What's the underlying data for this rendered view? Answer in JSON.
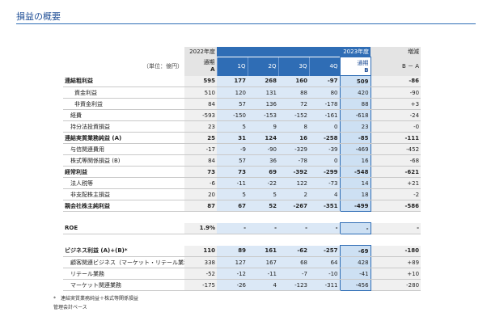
{
  "page": {
    "title": "損益の概要"
  },
  "table": {
    "unit": "（単位：億円）",
    "fy2022": "2022年度",
    "fy2023": "2023年度",
    "full_year": "通期",
    "col_a": "A",
    "col_b": "B",
    "q1": "1Q",
    "q2": "2Q",
    "q3": "3Q",
    "q4": "4Q",
    "diff_label": "増減",
    "diff_formula": "B － A",
    "rows": [
      {
        "label": "連結粗利益",
        "a": "595",
        "q1": "177",
        "q2": "268",
        "q3": "160",
        "q4": "-97",
        "b": "509",
        "d": "-86"
      },
      {
        "label": "資金利益",
        "a": "510",
        "q1": "120",
        "q2": "131",
        "q3": "88",
        "q4": "80",
        "b": "420",
        "d": "-90"
      },
      {
        "label": "非資金利益",
        "a": "84",
        "q1": "57",
        "q2": "136",
        "q3": "72",
        "q4": "-178",
        "b": "88",
        "d": "+3"
      },
      {
        "label": "経費",
        "a": "-593",
        "q1": "-150",
        "q2": "-153",
        "q3": "-152",
        "q4": "-161",
        "b": "-618",
        "d": "-24"
      },
      {
        "label": "持分法投資損益",
        "a": "23",
        "q1": "5",
        "q2": "9",
        "q3": "8",
        "q4": "0",
        "b": "23",
        "d": "-0"
      },
      {
        "label": "連結実質業務純益 (A)",
        "a": "25",
        "q1": "31",
        "q2": "124",
        "q3": "16",
        "q4": "-258",
        "b": "-85",
        "d": "-111"
      },
      {
        "label": "与信関連費用",
        "a": "-17",
        "q1": "-9",
        "q2": "-90",
        "q3": "-329",
        "q4": "-39",
        "b": "-469",
        "d": "-452"
      },
      {
        "label": "株式等関係損益 (B)",
        "a": "84",
        "q1": "57",
        "q2": "36",
        "q3": "-78",
        "q4": "0",
        "b": "16",
        "d": "-68"
      },
      {
        "label": "経常利益",
        "a": "73",
        "q1": "73",
        "q2": "69",
        "q3": "-392",
        "q4": "-299",
        "b": "-548",
        "d": "-621"
      },
      {
        "label": "法人税等",
        "a": "-6",
        "q1": "-11",
        "q2": "-22",
        "q3": "122",
        "q4": "-73",
        "b": "14",
        "d": "+21"
      },
      {
        "label": "非支配株主損益",
        "a": "20",
        "q1": "5",
        "q2": "5",
        "q3": "2",
        "q4": "4",
        "b": "18",
        "d": "-2"
      },
      {
        "label": "親会社株主純利益",
        "a": "87",
        "q1": "67",
        "q2": "52",
        "q3": "-267",
        "q4": "-351",
        "b": "-499",
        "d": "-586"
      },
      {
        "label": "ROE",
        "a": "1.9%",
        "q1": "-",
        "q2": "-",
        "q3": "-",
        "q4": "-",
        "b": "-",
        "d": "-"
      },
      {
        "label": "ビジネス利益 (A)+(B)*",
        "a": "110",
        "q1": "89",
        "q2": "161",
        "q3": "-62",
        "q4": "-257",
        "b": "-69",
        "d": "-180"
      },
      {
        "label": "顧客関連ビジネス（マーケット・リテール業務除く）",
        "a": "338",
        "q1": "127",
        "q2": "167",
        "q3": "68",
        "q4": "64",
        "b": "428",
        "d": "+89"
      },
      {
        "label": "リテール業務",
        "a": "-52",
        "q1": "-12",
        "q2": "-11",
        "q3": "-7",
        "q4": "-10",
        "b": "-41",
        "d": "+10"
      },
      {
        "label": "マーケット関連業務",
        "a": "-175",
        "q1": "-26",
        "q2": "4",
        "q3": "-123",
        "q4": "-311",
        "b": "-456",
        "d": "-280"
      }
    ]
  },
  "notes": {
    "note1": "*　連結実質業務純益＋株式等関係損益",
    "note2": "管理会計ベース"
  }
}
